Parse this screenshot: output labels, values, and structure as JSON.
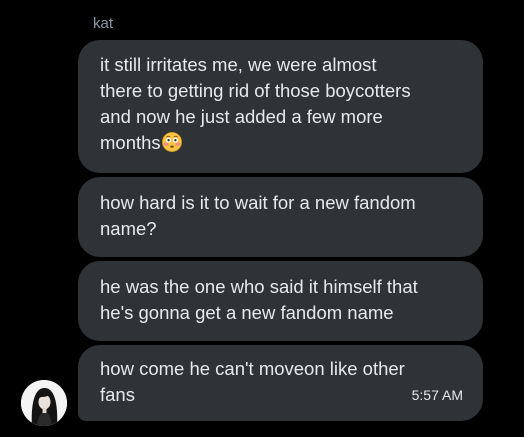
{
  "conversation": {
    "sender_name": "kat",
    "messages": [
      {
        "lines": [
          "it still irritates me, we were almost",
          "there to getting rid of those boycotters",
          "and now he just added a few more",
          "months"
        ],
        "emoji": "flushed-face"
      },
      {
        "lines": [
          "how hard is it to wait for a new fandom",
          "name?"
        ]
      },
      {
        "lines": [
          "he was the one who said it himself that",
          "he's gonna get a new fandom name"
        ]
      },
      {
        "lines": [
          "how come he can't moveon like other",
          "fans"
        ],
        "timestamp": "5:57 AM"
      }
    ]
  },
  "colors": {
    "background": "#000000",
    "bubble": "#2f3336",
    "text": "#e7e9ea",
    "sender": "#8b98a5"
  }
}
